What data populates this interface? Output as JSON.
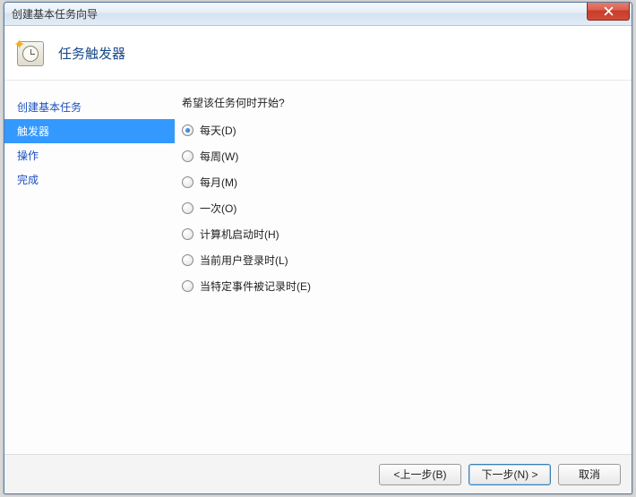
{
  "window": {
    "title": "创建基本任务向导"
  },
  "header": {
    "title": "任务触发器"
  },
  "sidebar": {
    "items": [
      {
        "label": "创建基本任务",
        "active": false
      },
      {
        "label": "触发器",
        "active": true
      },
      {
        "label": "操作",
        "active": false
      },
      {
        "label": "完成",
        "active": false
      }
    ]
  },
  "content": {
    "prompt": "希望该任务何时开始?",
    "options": [
      {
        "label": "每天(D)",
        "checked": true
      },
      {
        "label": "每周(W)",
        "checked": false
      },
      {
        "label": "每月(M)",
        "checked": false
      },
      {
        "label": "一次(O)",
        "checked": false
      },
      {
        "label": "计算机启动时(H)",
        "checked": false
      },
      {
        "label": "当前用户登录时(L)",
        "checked": false
      },
      {
        "label": "当特定事件被记录时(E)",
        "checked": false
      }
    ]
  },
  "footer": {
    "back": "<上一步(B)",
    "next": "下一步(N) >",
    "cancel": "取消"
  }
}
